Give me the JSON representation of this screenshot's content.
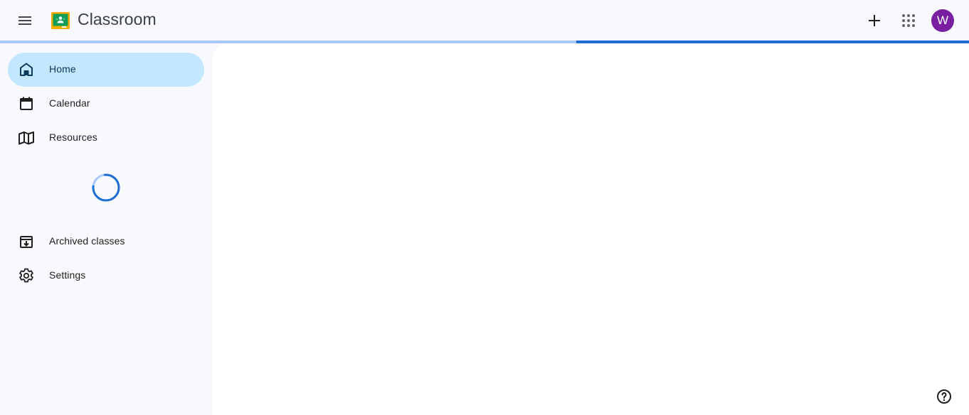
{
  "header": {
    "app_title": "Classroom",
    "menu_icon": "hamburger-menu-icon",
    "logo_icon": "google-classroom-logo",
    "add_icon": "plus-icon",
    "apps_icon": "apps-grid-icon",
    "avatar_initial": "W",
    "avatar_color": "#7b1fa2"
  },
  "progress": {
    "loaded_fraction": 0.595,
    "track_color": "#a8c7fa",
    "fill_color": "#1f6fd0"
  },
  "sidebar": {
    "items": [
      {
        "label": "Home",
        "icon": "home-icon",
        "active": true
      },
      {
        "label": "Calendar",
        "icon": "calendar-icon",
        "active": false
      },
      {
        "label": "Resources",
        "icon": "resources-book-icon",
        "active": false
      },
      {
        "label": "Archived classes",
        "icon": "archive-icon",
        "active": false
      },
      {
        "label": "Settings",
        "icon": "gear-icon",
        "active": false
      }
    ],
    "loading_indicator": "spinner"
  },
  "footer": {
    "help_icon": "help-icon"
  },
  "colors": {
    "accent": "#1f6fd0",
    "active_nav_bg": "#c2e7ff",
    "background": "#f8f9fc",
    "content_bg": "#ffffff"
  }
}
